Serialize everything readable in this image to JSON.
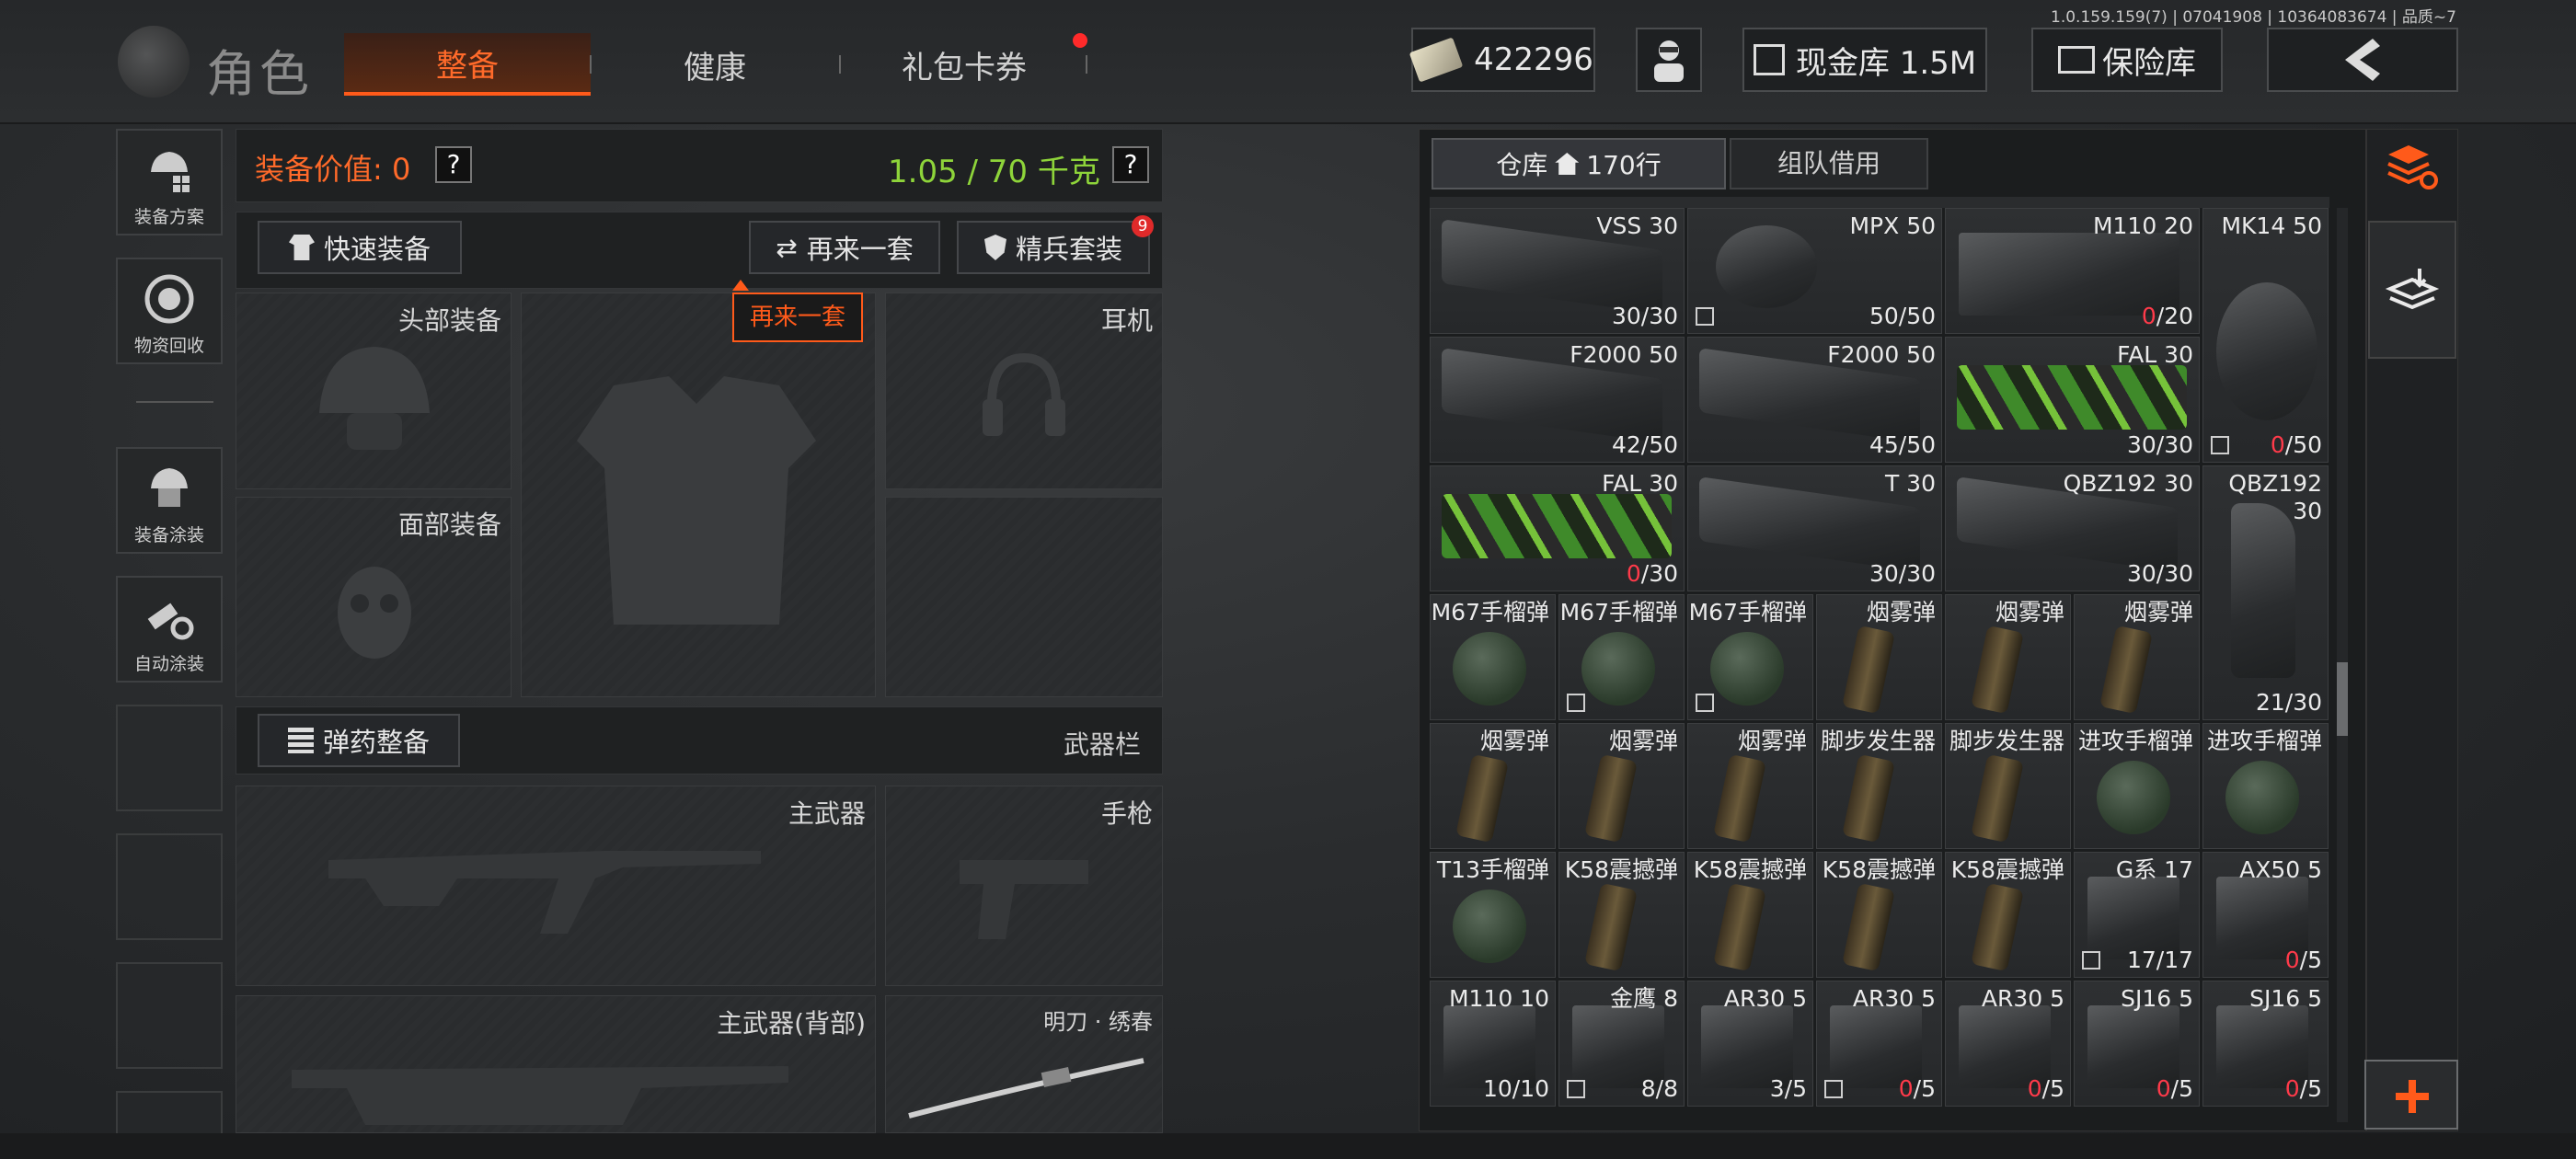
{
  "version": "1.0.159.159(7) | 07041908 | 10364083674 | 品质~7",
  "header": {
    "logo_text": "角色",
    "tabs": [
      {
        "label": "整备",
        "active": true
      },
      {
        "label": "健康",
        "active": false
      },
      {
        "label": "礼包卡券",
        "active": false,
        "badge": true
      }
    ],
    "currency": "422296",
    "cash_vault": "现金库 1.5M",
    "safe_vault": "保险库",
    "back_icon": "chevron-left-icon"
  },
  "rail": {
    "items": [
      {
        "label": "装备方案",
        "icon": "loadout-plan-icon"
      },
      {
        "label": "物资回收",
        "icon": "recycle-icon"
      },
      {
        "label": "装备涂装",
        "icon": "paint-icon"
      },
      {
        "label": "自动涂装",
        "icon": "auto-paint-icon"
      }
    ]
  },
  "equip": {
    "value_label": "装备价值: 0",
    "weight": "1.05 / 70 千克",
    "help": "?",
    "quick_equip": "快速装备",
    "again": "再来一套",
    "elite": "精兵套装",
    "elite_badge": "9",
    "tooltip": "再来一套",
    "slots": {
      "head": "头部装备",
      "face": "面部装备",
      "ear": "耳机",
      "ammo_btn": "弹药整备",
      "weapon_bar": "武器栏",
      "primary": "主武器",
      "pistol": "手枪",
      "primary_back": "主武器(背部)",
      "melee": "明刀 · 绣春"
    }
  },
  "inventory": {
    "tab_storage": "仓库",
    "tab_storage_count": "170行",
    "tab_team": "组队借用",
    "items": [
      {
        "name": "VSS 30",
        "count": "30/30",
        "zero": false,
        "type": "mag",
        "col": 0,
        "row": 0,
        "w": 2
      },
      {
        "name": "MPX 50",
        "count": "50/50",
        "zero": false,
        "type": "drum",
        "col": 2,
        "row": 0,
        "w": 2,
        "tag": true
      },
      {
        "name": "M110 20",
        "count": "/20",
        "zero": true,
        "type": "box",
        "col": 4,
        "row": 0,
        "w": 2
      },
      {
        "name": "MK14 50",
        "count": "/50",
        "zero": true,
        "type": "drum",
        "col": 6,
        "row": 0,
        "w": 1,
        "h": 2,
        "tag": true
      },
      {
        "name": "F2000 50",
        "count": "42/50",
        "zero": false,
        "type": "mag",
        "col": 0,
        "row": 1,
        "w": 2
      },
      {
        "name": "F2000 50",
        "count": "45/50",
        "zero": false,
        "type": "mag",
        "col": 2,
        "row": 1,
        "w": 2
      },
      {
        "name": "FAL 30",
        "count": "30/30",
        "zero": false,
        "type": "camo",
        "col": 4,
        "row": 1,
        "w": 2
      },
      {
        "name": "FAL 30",
        "count": "/30",
        "zero": true,
        "type": "camo",
        "col": 0,
        "row": 2,
        "w": 2
      },
      {
        "name": "T 30",
        "count": "30/30",
        "zero": false,
        "type": "mag",
        "col": 2,
        "row": 2,
        "w": 2
      },
      {
        "name": "QBZ192 30",
        "count": "30/30",
        "zero": false,
        "type": "mag",
        "col": 4,
        "row": 2,
        "w": 2
      },
      {
        "name": "QBZ192 30",
        "count": "21/30",
        "zero": false,
        "type": "curve",
        "col": 6,
        "row": 2,
        "w": 1,
        "h": 2
      },
      {
        "name": "M67手榴弹",
        "count": "",
        "type": "grenade",
        "col": 0,
        "row": 3,
        "w": 1
      },
      {
        "name": "M67手榴弹",
        "count": "",
        "type": "grenade",
        "col": 1,
        "row": 3,
        "w": 1,
        "tag": true
      },
      {
        "name": "M67手榴弹",
        "count": "",
        "type": "grenade",
        "col": 2,
        "row": 3,
        "w": 1,
        "tag": true
      },
      {
        "name": "烟雾弹",
        "count": "",
        "type": "smoke",
        "col": 3,
        "row": 3,
        "w": 1
      },
      {
        "name": "烟雾弹",
        "count": "",
        "type": "smoke",
        "col": 4,
        "row": 3,
        "w": 1
      },
      {
        "name": "烟雾弹",
        "count": "",
        "type": "smoke",
        "col": 5,
        "row": 3,
        "w": 1
      },
      {
        "name": "烟雾弹",
        "count": "",
        "type": "smoke",
        "col": 0,
        "row": 4,
        "w": 1
      },
      {
        "name": "烟雾弹",
        "count": "",
        "type": "smoke",
        "col": 1,
        "row": 4,
        "w": 1
      },
      {
        "name": "烟雾弹",
        "count": "",
        "type": "smoke",
        "col": 2,
        "row": 4,
        "w": 1
      },
      {
        "name": "脚步发生器",
        "count": "",
        "type": "smoke",
        "col": 3,
        "row": 4,
        "w": 1
      },
      {
        "name": "脚步发生器",
        "count": "",
        "type": "smoke",
        "col": 4,
        "row": 4,
        "w": 1
      },
      {
        "name": "进攻手榴弹",
        "count": "",
        "type": "grenade",
        "col": 5,
        "row": 4,
        "w": 1
      },
      {
        "name": "进攻手榴弹",
        "count": "",
        "type": "grenade",
        "col": 6,
        "row": 4,
        "w": 1
      },
      {
        "name": "T13手榴弹",
        "count": "",
        "type": "grenade",
        "col": 0,
        "row": 5,
        "w": 1
      },
      {
        "name": "K58震撼弹",
        "count": "",
        "type": "smoke",
        "col": 1,
        "row": 5,
        "w": 1
      },
      {
        "name": "K58震撼弹",
        "count": "",
        "type": "smoke",
        "col": 2,
        "row": 5,
        "w": 1
      },
      {
        "name": "K58震撼弹",
        "count": "",
        "type": "smoke",
        "col": 3,
        "row": 5,
        "w": 1
      },
      {
        "name": "K58震撼弹",
        "count": "",
        "type": "smoke",
        "col": 4,
        "row": 5,
        "w": 1
      },
      {
        "name": "G系 17",
        "count": "17/17",
        "zero": false,
        "type": "box",
        "col": 5,
        "row": 5,
        "w": 1,
        "tag": true
      },
      {
        "name": "AX50 5",
        "count": "/5",
        "zero": true,
        "type": "box",
        "col": 6,
        "row": 5,
        "w": 1
      },
      {
        "name": "M110 10",
        "count": "10/10",
        "zero": false,
        "type": "box",
        "col": 0,
        "row": 6,
        "w": 1
      },
      {
        "name": "金鹰 8",
        "count": "8/8",
        "zero": false,
        "type": "box",
        "col": 1,
        "row": 6,
        "w": 1,
        "tag": true
      },
      {
        "name": "AR30 5",
        "count": "3/5",
        "zero": false,
        "type": "box",
        "col": 2,
        "row": 6,
        "w": 1
      },
      {
        "name": "AR30 5",
        "count": "/5",
        "zero": true,
        "type": "box",
        "col": 3,
        "row": 6,
        "w": 1,
        "tag": true
      },
      {
        "name": "AR30 5",
        "count": "/5",
        "zero": true,
        "type": "box",
        "col": 4,
        "row": 6,
        "w": 1
      },
      {
        "name": "SJ16 5",
        "count": "/5",
        "zero": true,
        "type": "box",
        "col": 5,
        "row": 6,
        "w": 1
      },
      {
        "name": "SJ16 5",
        "count": "/5",
        "zero": true,
        "type": "box",
        "col": 6,
        "row": 6,
        "w": 1
      }
    ]
  },
  "side": {
    "top_icon": "layers-refresh-icon",
    "stack_icon": "stack-download-icon",
    "add_icon": "plus-icon"
  },
  "colors": {
    "accent": "#ff5a1a",
    "weight_green": "#8ed43a",
    "zero_red": "#ff3a4a"
  }
}
